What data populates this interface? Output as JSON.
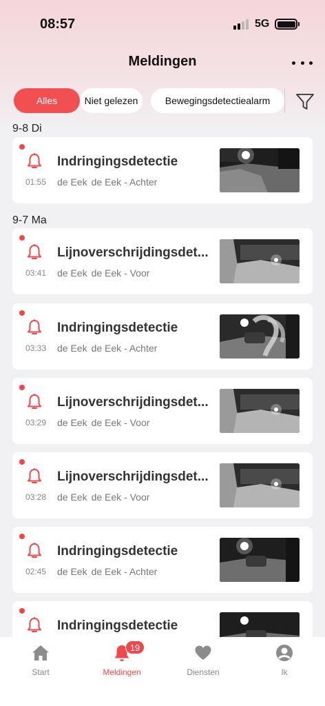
{
  "status_bar": {
    "time": "08:57",
    "network": "5G"
  },
  "header": {
    "title": "Meldingen",
    "more_icon": "more-horizontal-icon"
  },
  "filters": [
    {
      "label": "Alles",
      "active": true
    },
    {
      "label": "Niet gelezen",
      "active": false
    },
    {
      "label": "Bewegingsdetectiealarm",
      "active": false
    }
  ],
  "filter_icon": "funnel-icon",
  "groups": [
    {
      "date": "9-8 Di",
      "items": [
        {
          "title": "Indringingsdetectie",
          "time": "01:55",
          "device": "de Eek",
          "camera": "de Eek - Achter",
          "unread": true
        }
      ]
    },
    {
      "date": "9-7 Ma",
      "items": [
        {
          "title": "Lijnoverschrijdingsdet...",
          "time": "03:41",
          "device": "de Eek",
          "camera": "de Eek - Voor",
          "unread": true
        },
        {
          "title": "Indringingsdetectie",
          "time": "03:33",
          "device": "de Eek",
          "camera": "de Eek - Achter",
          "unread": true
        },
        {
          "title": "Lijnoverschrijdingsdet...",
          "time": "03:29",
          "device": "de Eek",
          "camera": "de Eek - Voor",
          "unread": true
        },
        {
          "title": "Lijnoverschrijdingsdet...",
          "time": "03:28",
          "device": "de Eek",
          "camera": "de Eek - Voor",
          "unread": true
        },
        {
          "title": "Indringingsdetectie",
          "time": "02:45",
          "device": "de Eek",
          "camera": "de Eek - Achter",
          "unread": true
        },
        {
          "title": "Indringingsdetectie",
          "time": "",
          "device": "",
          "camera": "",
          "unread": true
        }
      ]
    }
  ],
  "tab_bar": [
    {
      "label": "Start",
      "icon": "house-icon",
      "active": false
    },
    {
      "label": "Meldingen",
      "icon": "bell-icon",
      "active": true,
      "badge": "19"
    },
    {
      "label": "Diensten",
      "icon": "heart-icon",
      "active": false
    },
    {
      "label": "Ik",
      "icon": "person-icon",
      "active": false
    }
  ],
  "colors": {
    "accent": "#f0474a",
    "chip_active": "#f24f52",
    "tab_inactive": "#888888"
  }
}
